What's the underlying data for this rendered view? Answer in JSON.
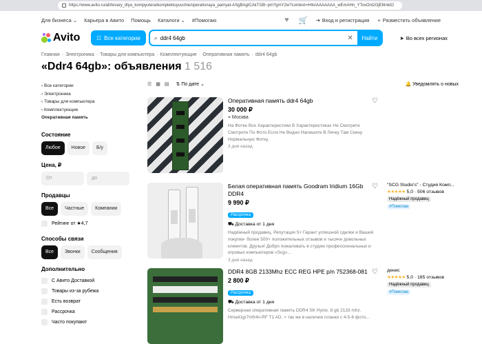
{
  "browser": {
    "url": "https://www.avito.ru/all/tovary_dlya_kompyutera/komplektuyuschie/operativnaya_pamyat-ASgBAgICAkTGB~pm?gmY2w?context=H4sIAAAAAAA_wEmAHn_YToxOntzOjE6InkiO"
  },
  "topnav": {
    "items": [
      "Для бизнеса ⌄",
      "Карьера в Авито",
      "Помощь",
      "Каталоги ⌄",
      "#Помогаю"
    ],
    "login": "Вход и регистрация",
    "post_ad": "Разместить объявление"
  },
  "header": {
    "logo_text": "Avito",
    "categories_button": "Все категории",
    "search_value": "ddr4 64gb",
    "find_button": "Найти",
    "region": "Во всех регионах"
  },
  "breadcrumb": [
    "Главная",
    "Электроника",
    "Товары для компьютера",
    "Комплектующие",
    "Оперативная память",
    "ddr4 64gb"
  ],
  "page": {
    "title": "«Ddr4 64gb»: объявления",
    "count": "1 516"
  },
  "sidebar": {
    "categories": [
      "Все категории",
      "Электроника",
      "Товары для компьютера",
      "Комплектующие",
      "Оперативная память"
    ],
    "condition": {
      "title": "Состояние",
      "options": [
        "Любое",
        "Новое",
        "Б/у"
      ]
    },
    "price": {
      "title": "Цена, ₽",
      "from": "От",
      "to": "до"
    },
    "sellers": {
      "title": "Продавцы",
      "options": [
        "Все",
        "Частные",
        "Компании"
      ],
      "rating": "Рейтинг от ★4,7"
    },
    "contact": {
      "title": "Способы связи",
      "options": [
        "Все",
        "Звонки",
        "Сообщения"
      ]
    },
    "extra": {
      "title": "Дополнительно",
      "options": [
        "С Авито Доставкой",
        "Товары из-за рубежа",
        "Есть возврат",
        "Рассрочка",
        "Часто покупают"
      ]
    }
  },
  "toolbar": {
    "sort": "По дате",
    "notify": "Уведомлять о новых"
  },
  "listings": [
    {
      "title": "Оперативная память ddr4 64gb",
      "price": "30 000 ₽",
      "location": "Москва",
      "description": "На Фотке Все Характеристики В Характеристиках Не Смотрите Смотрите По Фото Если Не Видно Напишите В Личку Там Скину Нормальную Фотку.",
      "date": "3 дня назад"
    },
    {
      "title": "Белая оперативная память Goodram Iridium 16Gb DDR4",
      "price": "9 990 ₽",
      "badge": "Рассрочка",
      "delivery": "Доставка от 1 дня",
      "description": "Надёжный продавец. Репутация 5+ Гарант успешной сделки и Вашей покупки- более 500+ положительных отзывов и тысячи довольных клиентов. Друзья! Добро пожаловать в студию профессиональных и игровых компьютеров «Scg»...",
      "date": "3 дня назад",
      "seller": {
        "name": "\"SCG Studio's\" - Студия Комп...",
        "rating": "5,0",
        "reviews": "506 отзывов",
        "badge": "Надёжный продавец",
        "help": "#Помогаю"
      }
    },
    {
      "title": "DDR4 8GB 2133Mhz ECC REG HPE p/n 752368-081",
      "price": "2 800 ₽",
      "badge": "Рассрочка",
      "delivery": "Доставка от 1 дня",
      "description": "Серверная оперативная память DDR4 SK Hynix. 8 gb 2133 mhz. Hma41gr7mfr4n-RF T1 AD. > так же в наличии планки с 4-5-6 фото...",
      "date": "",
      "seller": {
        "name": "денис",
        "rating": "5,0",
        "reviews": "165 отзывов",
        "badge": "Надёжный продавец",
        "help": "#Помогаю"
      }
    }
  ],
  "colors": {
    "accent": "#00aaff",
    "rating": "#ffb021"
  }
}
